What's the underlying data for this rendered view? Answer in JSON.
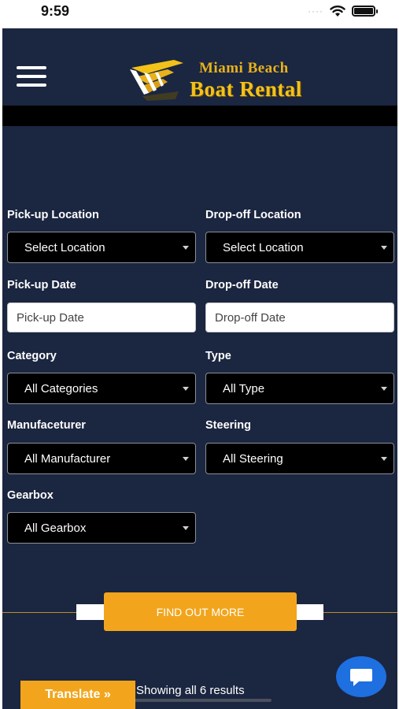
{
  "status_bar": {
    "time": "9:59",
    "signal_icon": "signal-dots-icon",
    "wifi_icon": "wifi-icon",
    "battery_icon": "battery-icon"
  },
  "header": {
    "menu_icon": "hamburger-menu-icon",
    "logo": {
      "line1": "Miami Beach",
      "line2": "Boat Rental",
      "mark_icon": "speed-chevrons-logo"
    }
  },
  "form": {
    "pickup_location": {
      "label": "Pick-up Location",
      "value": "Select Location"
    },
    "dropoff_location": {
      "label": "Drop-off Location",
      "value": "Select Location"
    },
    "pickup_date": {
      "label": "Pick-up Date",
      "placeholder": "Pick-up Date"
    },
    "dropoff_date": {
      "label": "Drop-off Date",
      "placeholder": "Drop-off Date"
    },
    "category": {
      "label": "Category",
      "value": "All Categories"
    },
    "type": {
      "label": "Type",
      "value": "All Type"
    },
    "manufacturer": {
      "label": "Manufaceturer",
      "value": "All Manufacturer"
    },
    "steering": {
      "label": "Steering",
      "value": "All Steering"
    },
    "gearbox": {
      "label": "Gearbox",
      "value": "All Gearbox"
    }
  },
  "cta": {
    "label": "FIND OUT MORE"
  },
  "results": {
    "text": "Showing all 6 results"
  },
  "translate": {
    "label": "Translate »"
  },
  "chat": {
    "icon": "chat-bubble-icon"
  },
  "colors": {
    "background": "#1b2640",
    "accent": "#f2a51c",
    "logo_gold": "#f2c21a",
    "chat_blue": "#1e6fe0"
  }
}
